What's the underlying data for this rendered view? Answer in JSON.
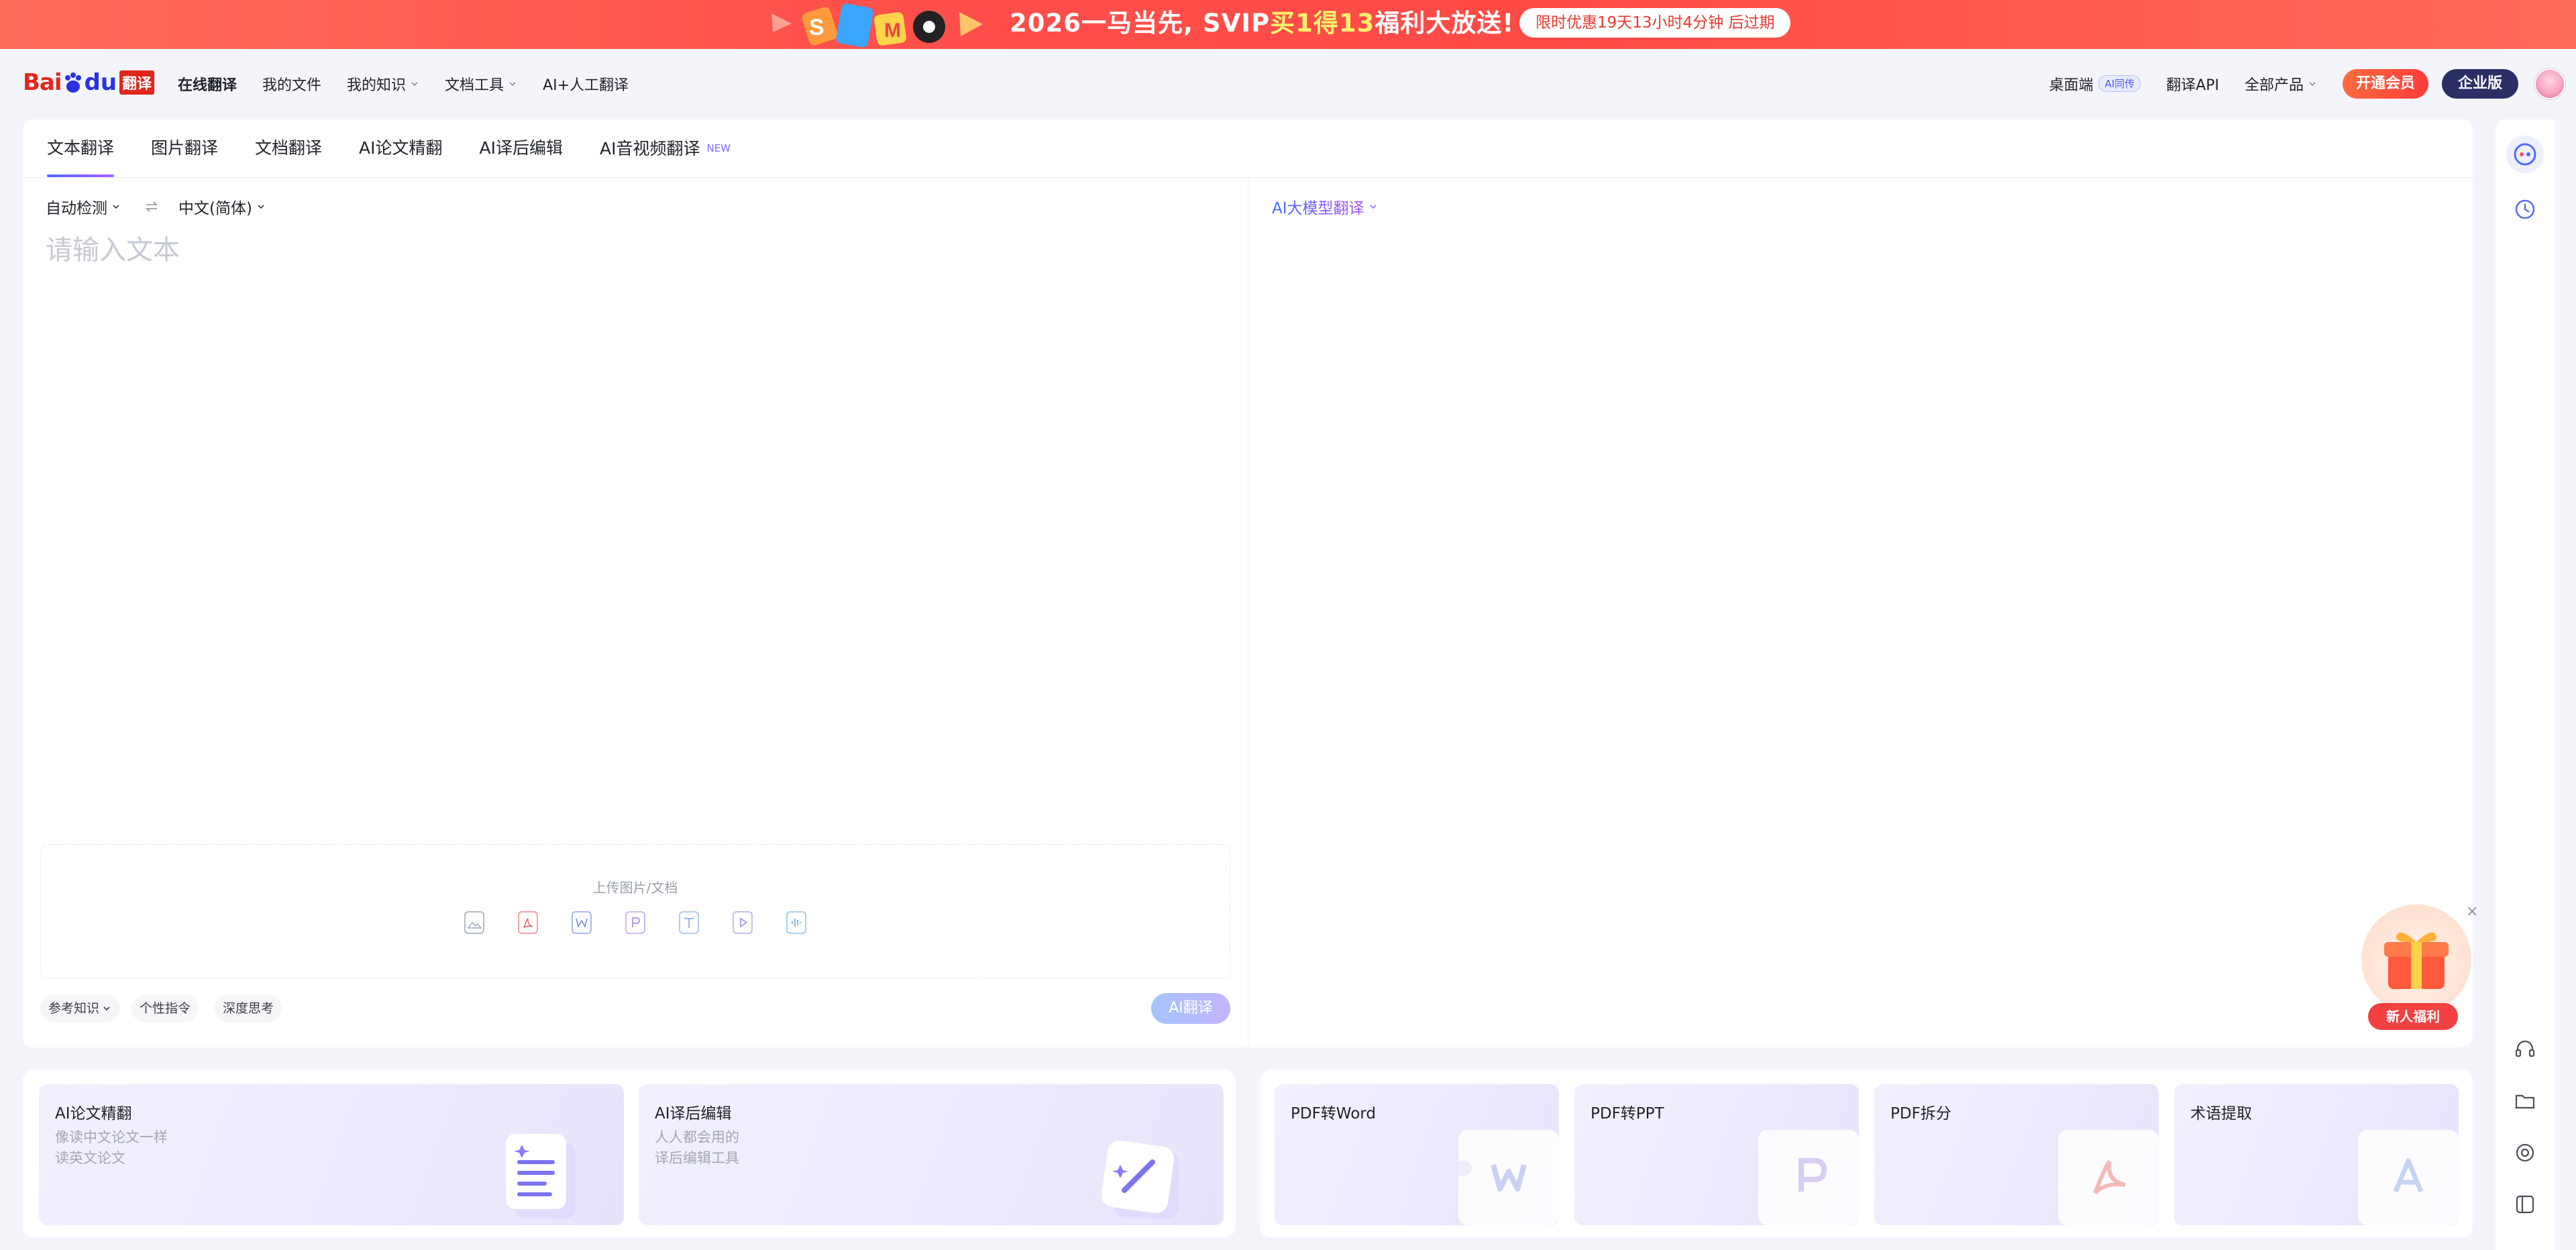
{
  "promo": {
    "title_pre": "2026一马当先, SVIP",
    "title_hl": "买1得13",
    "title_post": "福利大放送!",
    "timer": "限时优惠19天13小时4分钟 后过期"
  },
  "logo": {
    "bai": "Bai",
    "du": "du",
    "fanyi": "翻译"
  },
  "nav": {
    "items": [
      "在线翻译",
      "我的文件",
      "我的知识",
      "文档工具",
      "AI+人工翻译"
    ],
    "desktop": "桌面端",
    "desktop_tag": "AI同传",
    "api": "翻译API",
    "all_products": "全部产品",
    "vip": "开通会员",
    "enterprise": "企业版"
  },
  "tabs": [
    "文本翻译",
    "图片翻译",
    "文档翻译",
    "AI论文精翻",
    "AI译后编辑",
    "AI音视频翻译"
  ],
  "new_tag": "NEW",
  "source": {
    "lang_from": "自动检测",
    "lang_to": "中文(简体)",
    "placeholder": "请输入文本",
    "upload_title": "上传图片/文档",
    "upload_icons": [
      "image-icon",
      "pdf-icon",
      "word-icon",
      "ppt-icon",
      "txt-icon",
      "video-icon",
      "audio-icon"
    ],
    "chips": [
      "参考知识",
      "个性指令",
      "深度思考"
    ],
    "translate_btn": "AI翻译"
  },
  "target": {
    "model": "AI大模型翻译"
  },
  "gift": {
    "label": "新人福利",
    "close": "×"
  },
  "features": [
    {
      "title": "AI论文精翻",
      "desc1": "像读中文论文一样",
      "desc2": "读英文论文"
    },
    {
      "title": "AI译后编辑",
      "desc1": "人人都会用的",
      "desc2": "译后编辑工具"
    }
  ],
  "pdf_tools": [
    {
      "title": "PDF转Word",
      "letter": "W"
    },
    {
      "title": "PDF转PPT",
      "letter": "P"
    },
    {
      "title": "PDF拆分",
      "letter": ""
    },
    {
      "title": "术语提取",
      "letter": "A"
    }
  ],
  "colors": {
    "accent": "#4e6bff",
    "brand_red": "#e1261c",
    "brand_blue": "#2932e1"
  }
}
